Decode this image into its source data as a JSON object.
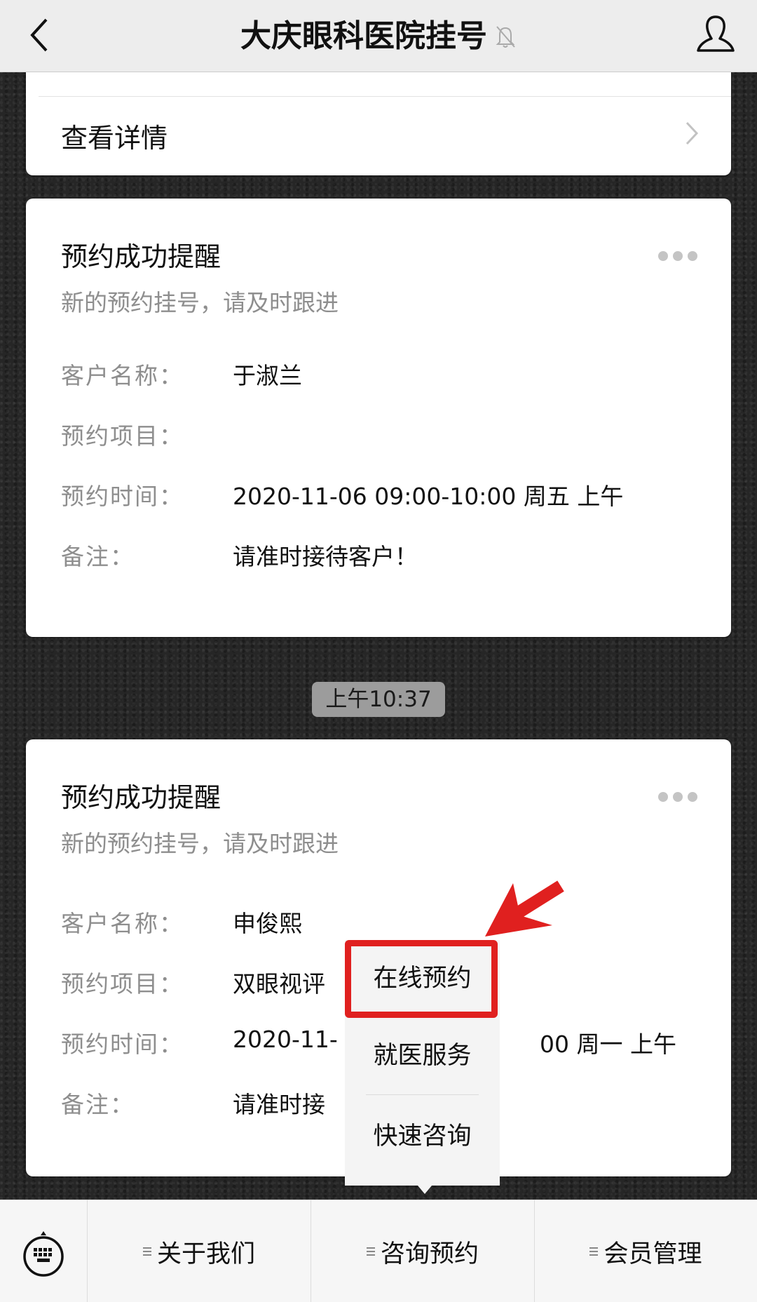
{
  "header": {
    "title": "大庆眼科医院挂号",
    "back_icon": "chevron-left-icon",
    "mute_icon": "bell-muted-icon",
    "profile_icon": "person-icon"
  },
  "top_card": {
    "detail_label": "查看详情",
    "chevron_icon": "chevron-right-icon"
  },
  "messages": [
    {
      "title": "预约成功提醒",
      "subtitle": "新的预约挂号，请及时跟进",
      "fields": [
        {
          "label": "客户名称：",
          "value": "于淑兰"
        },
        {
          "label": "预约项目：",
          "value": ""
        },
        {
          "label": "预约时间：",
          "value": "2020-11-06 09:00-10:00 周五 上午"
        },
        {
          "label": "备注：",
          "value": "请准时接待客户！"
        }
      ]
    },
    {
      "title": "预约成功提醒",
      "subtitle": "新的预约挂号，请及时跟进",
      "fields": [
        {
          "label": "客户名称：",
          "value": "申俊熙"
        },
        {
          "label": "预约项目：",
          "value": "双眼视评"
        },
        {
          "label": "预约时间：",
          "value": "2020-11-",
          "value_right": "00 周一 上午"
        },
        {
          "label": "备注：",
          "value": "请准时接"
        }
      ]
    }
  ],
  "timestamp": "上午10:37",
  "popup_menu": {
    "items": [
      "在线预约",
      "就医服务",
      "快速咨询"
    ],
    "highlighted_index": 0,
    "annotation_color": "#e0201f"
  },
  "bottom_bar": {
    "keyboard_icon": "keyboard-icon",
    "tabs": [
      "关于我们",
      "咨询预约",
      "会员管理"
    ],
    "open_tab_index": 1
  }
}
